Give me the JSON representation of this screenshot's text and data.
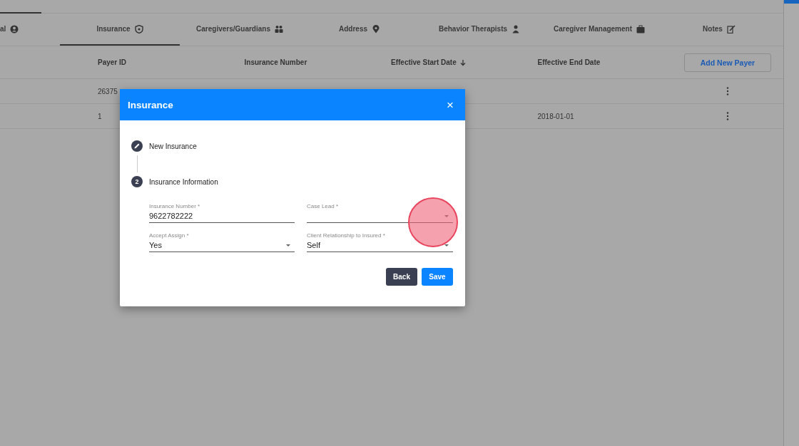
{
  "tabs": [
    {
      "label": "al",
      "selected": false
    },
    {
      "label": "Insurance",
      "selected": true
    },
    {
      "label": "Caregivers/Guardians",
      "selected": false
    },
    {
      "label": "Address",
      "selected": false
    },
    {
      "label": "Behavior Therapists",
      "selected": false
    },
    {
      "label": "Caregiver Management",
      "selected": false
    },
    {
      "label": "Notes",
      "selected": false
    }
  ],
  "table": {
    "columns": [
      {
        "label": "Payer ID",
        "sorted": false
      },
      {
        "label": "Insurance Number",
        "sorted": false
      },
      {
        "label": "Effective Start Date",
        "sorted": true
      },
      {
        "label": "Effective End Date",
        "sorted": false
      }
    ],
    "add_button": "Add New Payer",
    "rows": [
      [
        "26375",
        "",
        "",
        ""
      ],
      [
        "1",
        "",
        "",
        "2018-01-01"
      ]
    ]
  },
  "dialog": {
    "title": "Insurance",
    "close": "×",
    "steps": [
      {
        "label": "New Insurance",
        "kind": "done"
      },
      {
        "label": "Insurance Information",
        "kind": "active",
        "number": "2"
      }
    ],
    "fields": [
      {
        "label": "Insurance Number *",
        "value": "9622782222",
        "kind": "text"
      },
      {
        "label": "Case Lead *",
        "kind": "select"
      },
      {
        "label": "Accept Assign *",
        "value": "Yes",
        "kind": "select"
      },
      {
        "label": "Client Relationship to Insured *",
        "value": "Self",
        "kind": "select"
      }
    ],
    "buttons": [
      {
        "label": "Back",
        "kind": "secondary"
      },
      {
        "label": "Save",
        "kind": "primary"
      }
    ]
  }
}
